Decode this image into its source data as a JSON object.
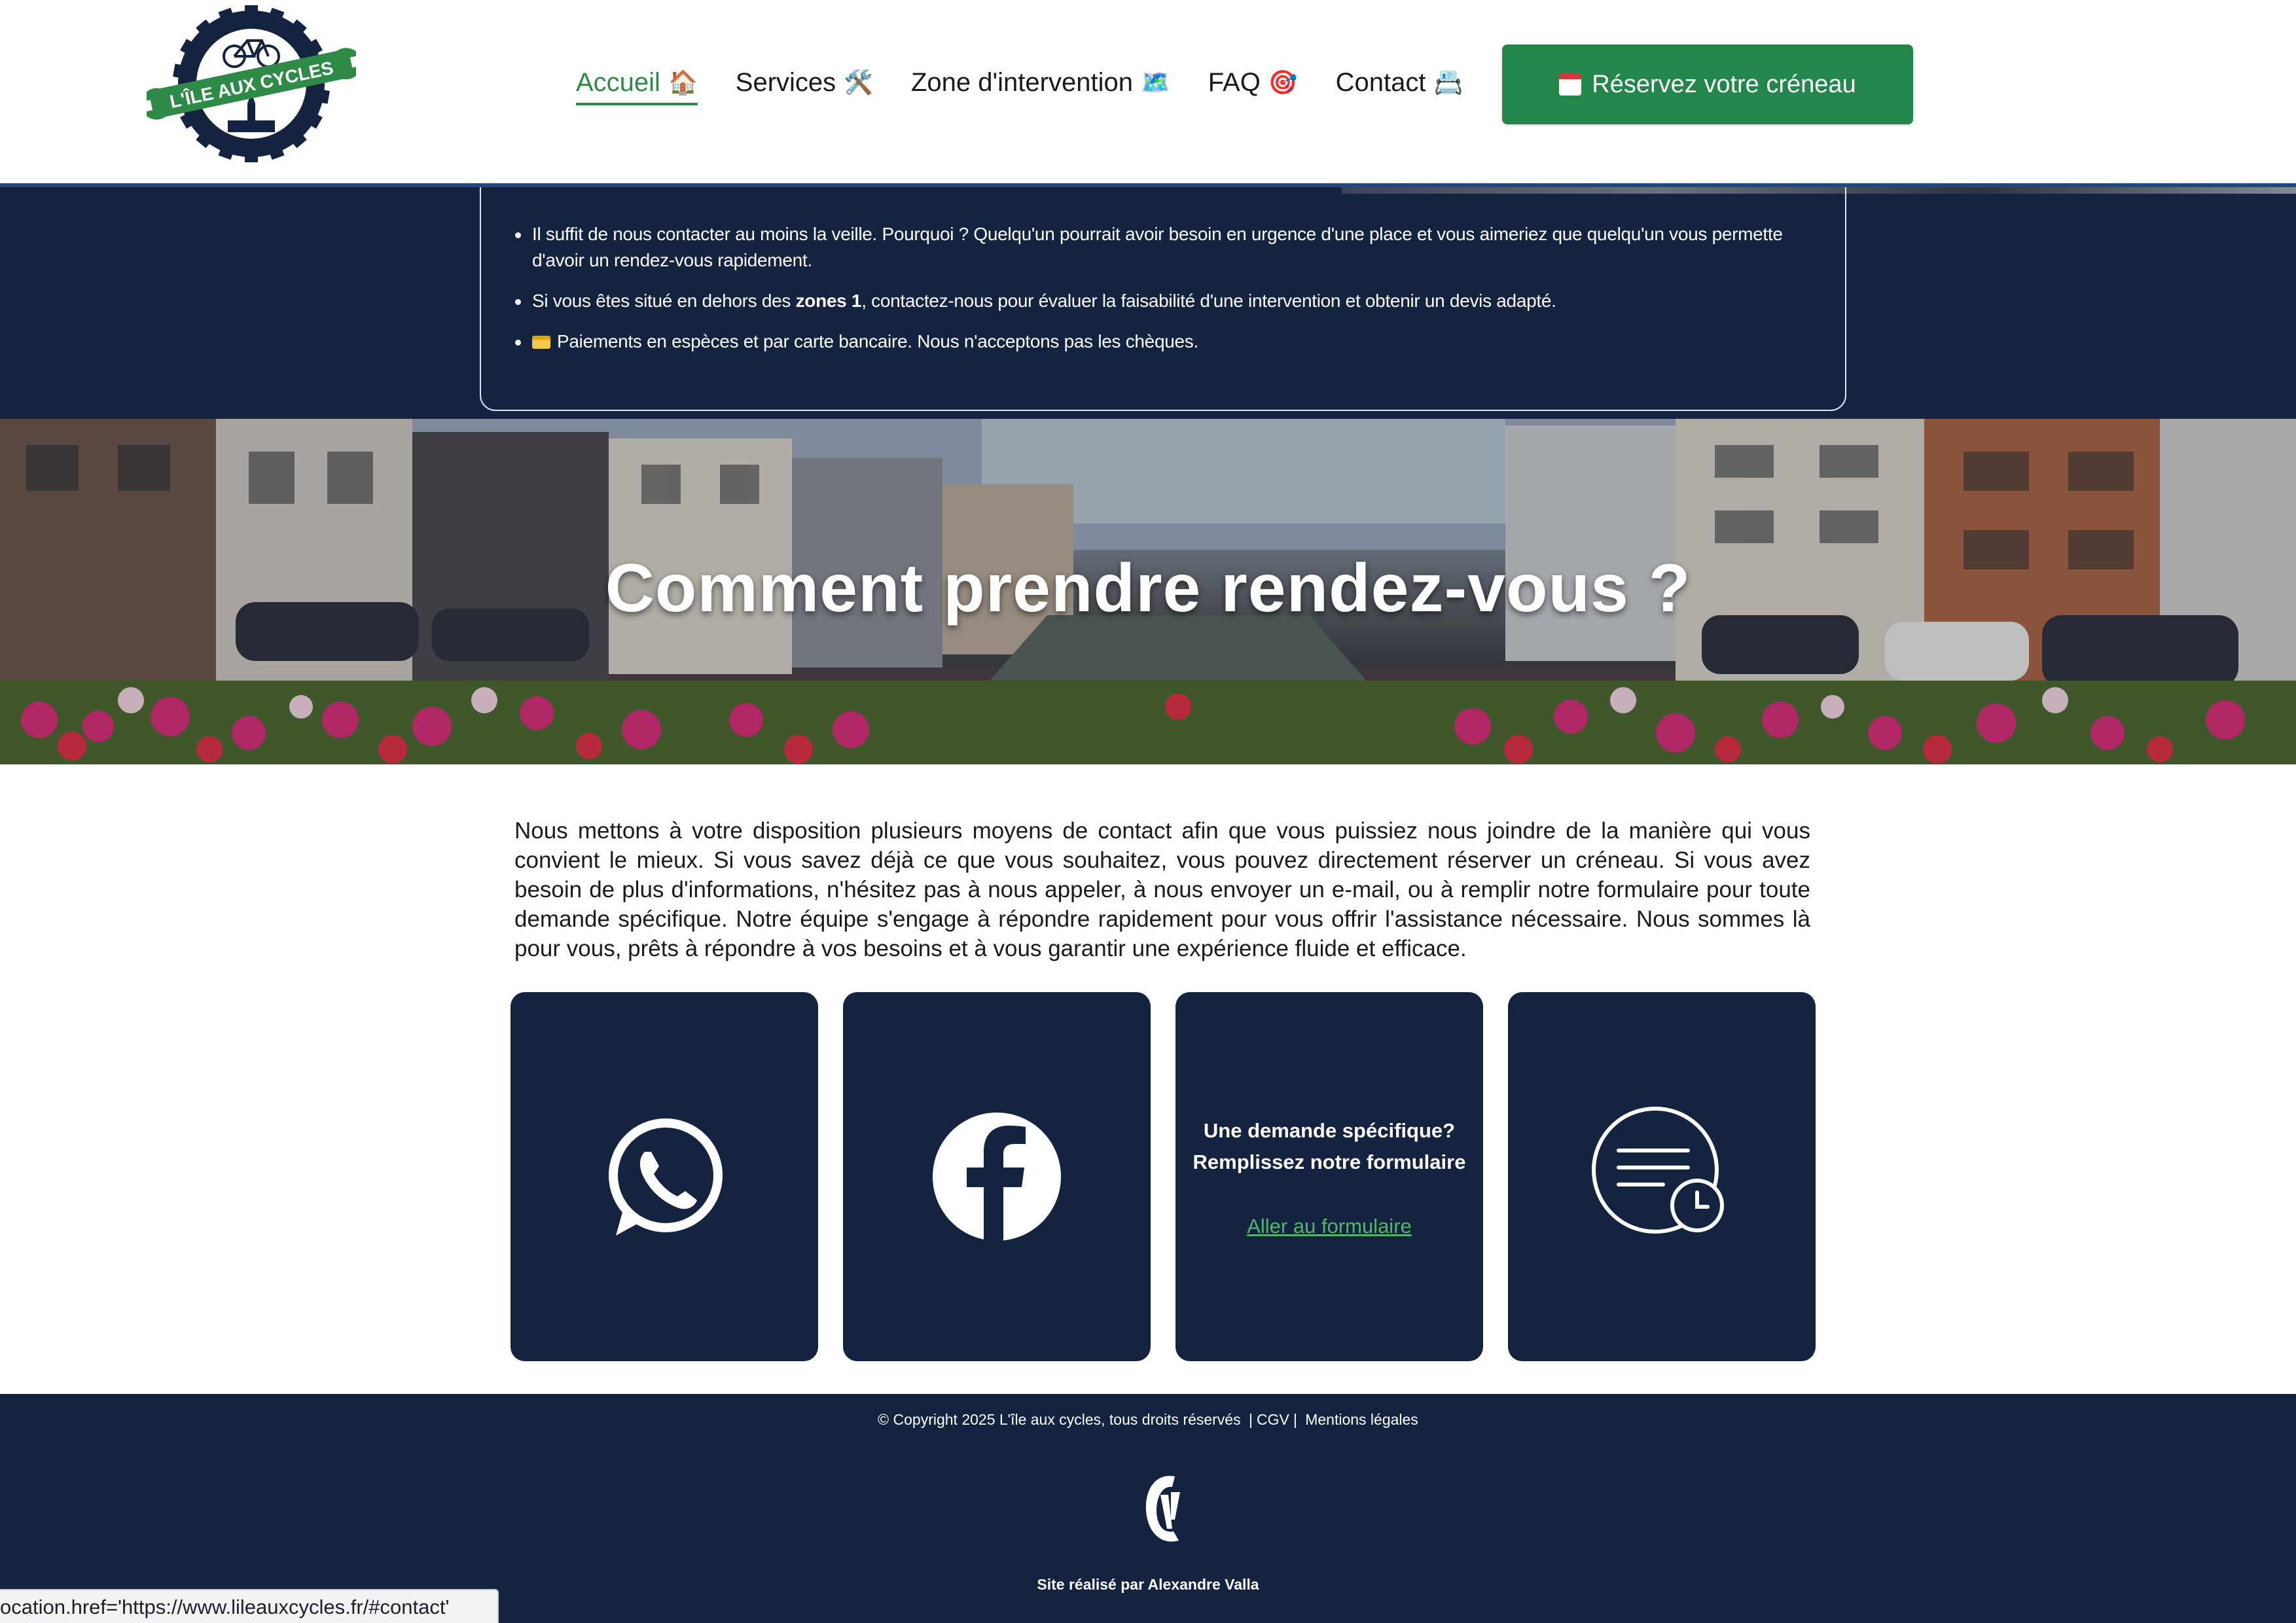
{
  "header": {
    "logo_text": "L'ÎLE AUX CYCLES",
    "nav": [
      {
        "label": "Accueil",
        "icon": "house-icon",
        "emoji": "🏠",
        "active": true
      },
      {
        "label": "Services",
        "icon": "tools-icon",
        "emoji": "🛠️",
        "active": false
      },
      {
        "label": "Zone d'intervention",
        "icon": "map-icon",
        "emoji": "🗺️",
        "active": false
      },
      {
        "label": "FAQ",
        "icon": "target-icon",
        "emoji": "🎯",
        "active": false
      },
      {
        "label": "Contact",
        "icon": "contact-card-icon",
        "emoji": "📇",
        "active": false
      }
    ],
    "cta_label": "Réservez votre créneau",
    "cta_icon": "calendar-icon"
  },
  "info": {
    "item1": "Il suffit de nous contacter au moins la veille. Pourquoi ? Quelqu'un pourrait avoir besoin en urgence d'une place et vous aimeriez que quelqu'un vous permette d'avoir un rendez-vous rapidement.",
    "item2_prefix": "Si vous êtes situé en dehors des ",
    "item2_bold": "zones 1",
    "item2_suffix": ", contactez-nous pour évaluer la faisabilité d'une intervention et obtenir un devis adapté.",
    "item3": "Paiements en espèces et par carte bancaire. Nous n'acceptons pas les chèques."
  },
  "hero": {
    "title": "Comment prendre rendez-vous ?"
  },
  "intro": {
    "text": "Nous mettons à votre disposition plusieurs moyens de contact afin que vous puissiez nous joindre de la manière qui vous convient le mieux. Si vous savez déjà ce que vous souhaitez, vous pouvez directement réserver un créneau. Si vous avez besoin de plus d'informations, n'hésitez pas à nous appeler, à nous envoyer un e-mail, ou à remplir notre formulaire pour toute demande spécifique. Notre équipe s'engage à répondre rapidement pour vous offrir l'assistance nécessaire. Nous sommes là pour vous, prêts à répondre à vos besoins et à vous garantir une expérience fluide et efficace."
  },
  "cards": {
    "whatsapp_icon": "whatsapp-icon",
    "facebook_icon": "facebook-icon",
    "form_line1": "Une demande spécifique?",
    "form_line2": "Remplissez notre formulaire",
    "form_link": "Aller au formulaire",
    "hours_icon": "message-clock-icon"
  },
  "footer": {
    "copyright": "© Copyright 2025 L'île aux cycles, tous droits réservés",
    "cgv": "CGV",
    "legal": "Mentions légales",
    "credit": "Site réalisé par Alexandre Valla"
  },
  "status_bar": {
    "text": "ocation.href='https://www.lileauxcycles.fr/#contact'"
  },
  "colors": {
    "navy": "#142440",
    "green": "#23864a",
    "link_green": "#4fb866"
  }
}
